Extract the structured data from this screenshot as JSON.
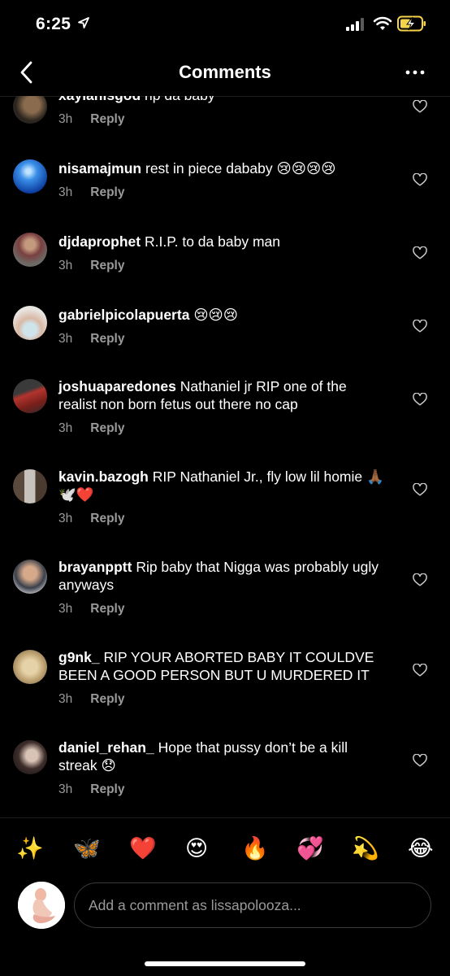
{
  "status_bar": {
    "time": "6:25"
  },
  "header": {
    "title": "Comments"
  },
  "comments": [
    {
      "username": "xaylanisgod",
      "text": "rip da baby",
      "time": "3h",
      "reply": "Reply"
    },
    {
      "username": "nisamajmun",
      "text": "rest in piece dababy 😢😢😢😢",
      "time": "3h",
      "reply": "Reply"
    },
    {
      "username": "djdaprophet",
      "text": "R.I.P. to da baby man",
      "time": "3h",
      "reply": "Reply"
    },
    {
      "username": "gabrielpicolapuerta",
      "text": "😢😢😢",
      "time": "3h",
      "reply": "Reply"
    },
    {
      "username": "joshuaparedones",
      "text": "Nathaniel jr RIP one of the realist non born fetus out there no cap",
      "time": "3h",
      "reply": "Reply"
    },
    {
      "username": "kavin.bazogh",
      "text": "RIP Nathaniel Jr., fly low lil homie 🙏🏾🕊️❤️",
      "time": "3h",
      "reply": "Reply"
    },
    {
      "username": "brayanpptt",
      "text": "Rip baby that Nigga was probably ugly anyways",
      "time": "3h",
      "reply": "Reply"
    },
    {
      "username": "g9nk_",
      "text": "RIP YOUR ABORTED BABY IT COULDVE BEEN A GOOD PERSON BUT U MURDERED IT",
      "time": "3h",
      "reply": "Reply"
    },
    {
      "username": "daniel_rehan_",
      "text": "Hope that pussy don’t be a kill streak 😞",
      "time": "3h",
      "reply": "Reply"
    }
  ],
  "emoji_bar": [
    "✨",
    "🦋",
    "❤️",
    "😍",
    "🔥",
    "💞",
    "💫",
    "😂"
  ],
  "composer": {
    "placeholder": "Add a comment as lissapolooza..."
  },
  "icons": {
    "back": "chevron-left-icon",
    "more": "ellipsis-icon",
    "like": "heart-outline-icon",
    "location": "location-arrow-icon",
    "signal": "cellular-signal-icon",
    "wifi": "wifi-icon",
    "battery": "battery-charging-icon"
  },
  "colors": {
    "background": "#000000",
    "secondary_text": "#9a9a9a",
    "battery": "#f5d34a"
  }
}
